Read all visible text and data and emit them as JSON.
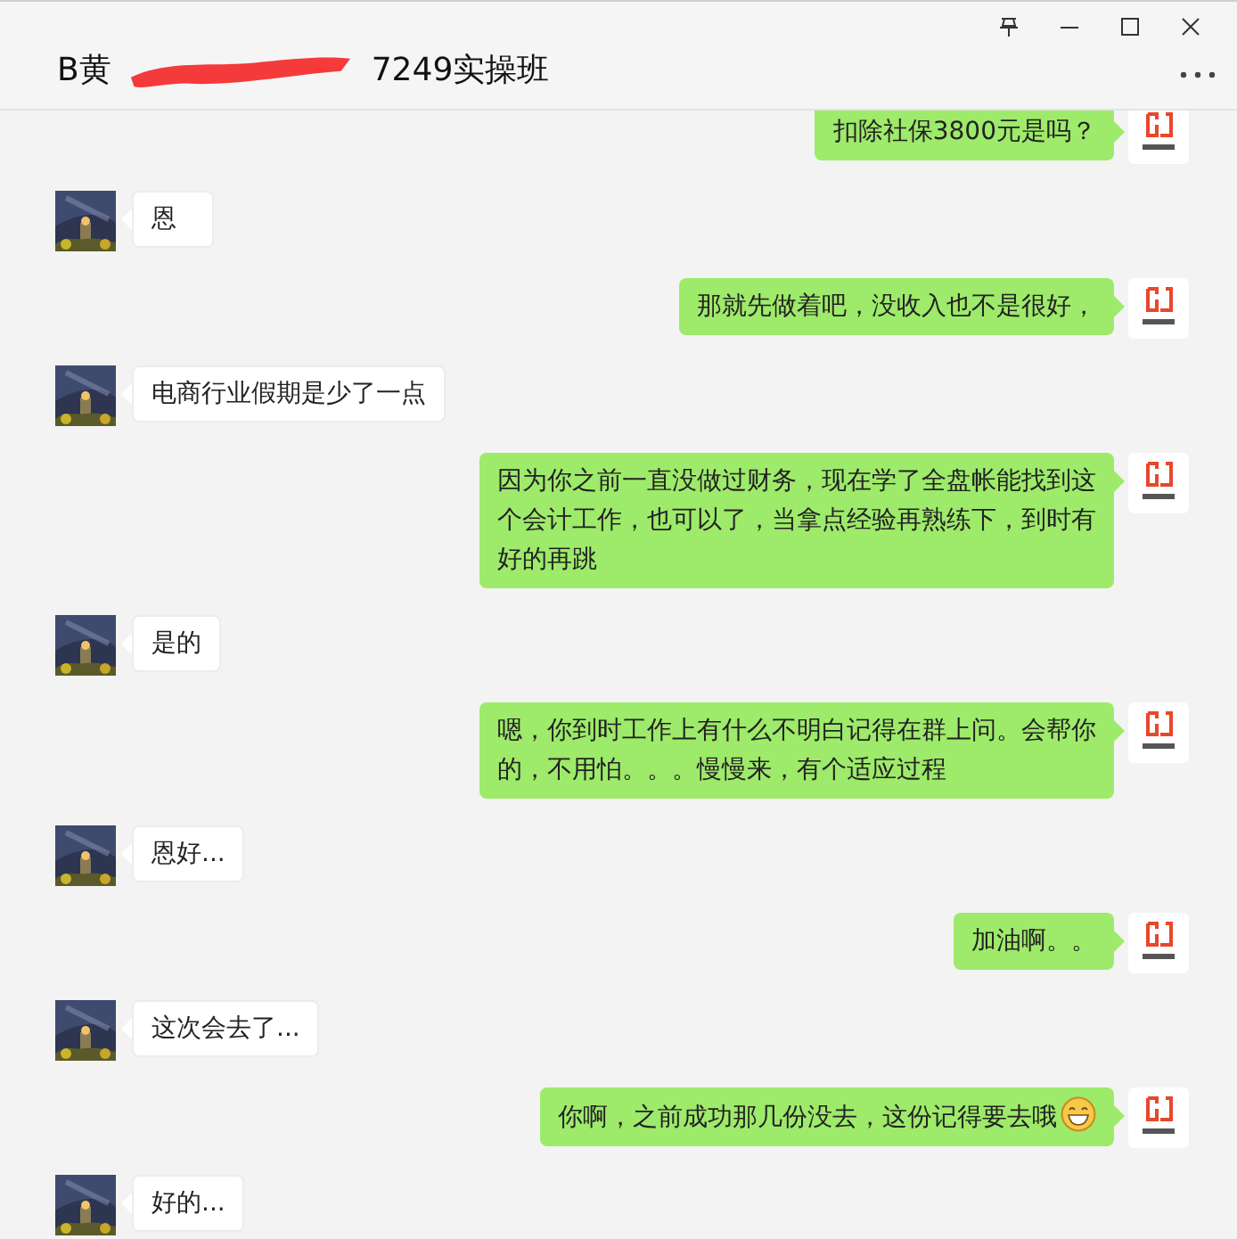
{
  "window": {
    "title_start": "B黄",
    "title_redacted": true,
    "title_end": "7249实操班"
  },
  "messages": [
    {
      "kind": "sent",
      "text": "扣除社保3800元是吗？"
    },
    {
      "kind": "received",
      "text": "恩"
    },
    {
      "kind": "sent",
      "text": "那就先做着吧，没收入也不是很好，"
    },
    {
      "kind": "received",
      "text": "电商行业假期是少了一点"
    },
    {
      "kind": "sent",
      "text": "因为你之前一直没做过财务，现在学了全盘帐能找到这个会计工作，也可以了，当拿点经验再熟练下，到时有好的再跳"
    },
    {
      "kind": "received",
      "text": "是的"
    },
    {
      "kind": "sent",
      "text": "嗯，你到时工作上有什么不明白记得在群上问。会帮你的，不用怕。。。慢慢来，有个适应过程"
    },
    {
      "kind": "received",
      "text": "恩好..."
    },
    {
      "kind": "sent",
      "text": "加油啊。。"
    },
    {
      "kind": "received",
      "text": "这次会去了..."
    },
    {
      "kind": "sent",
      "text": "你啊，之前成功那几份没去，这份记得要去哦",
      "grin_emoji": true
    },
    {
      "kind": "received",
      "text": "好的..."
    }
  ]
}
